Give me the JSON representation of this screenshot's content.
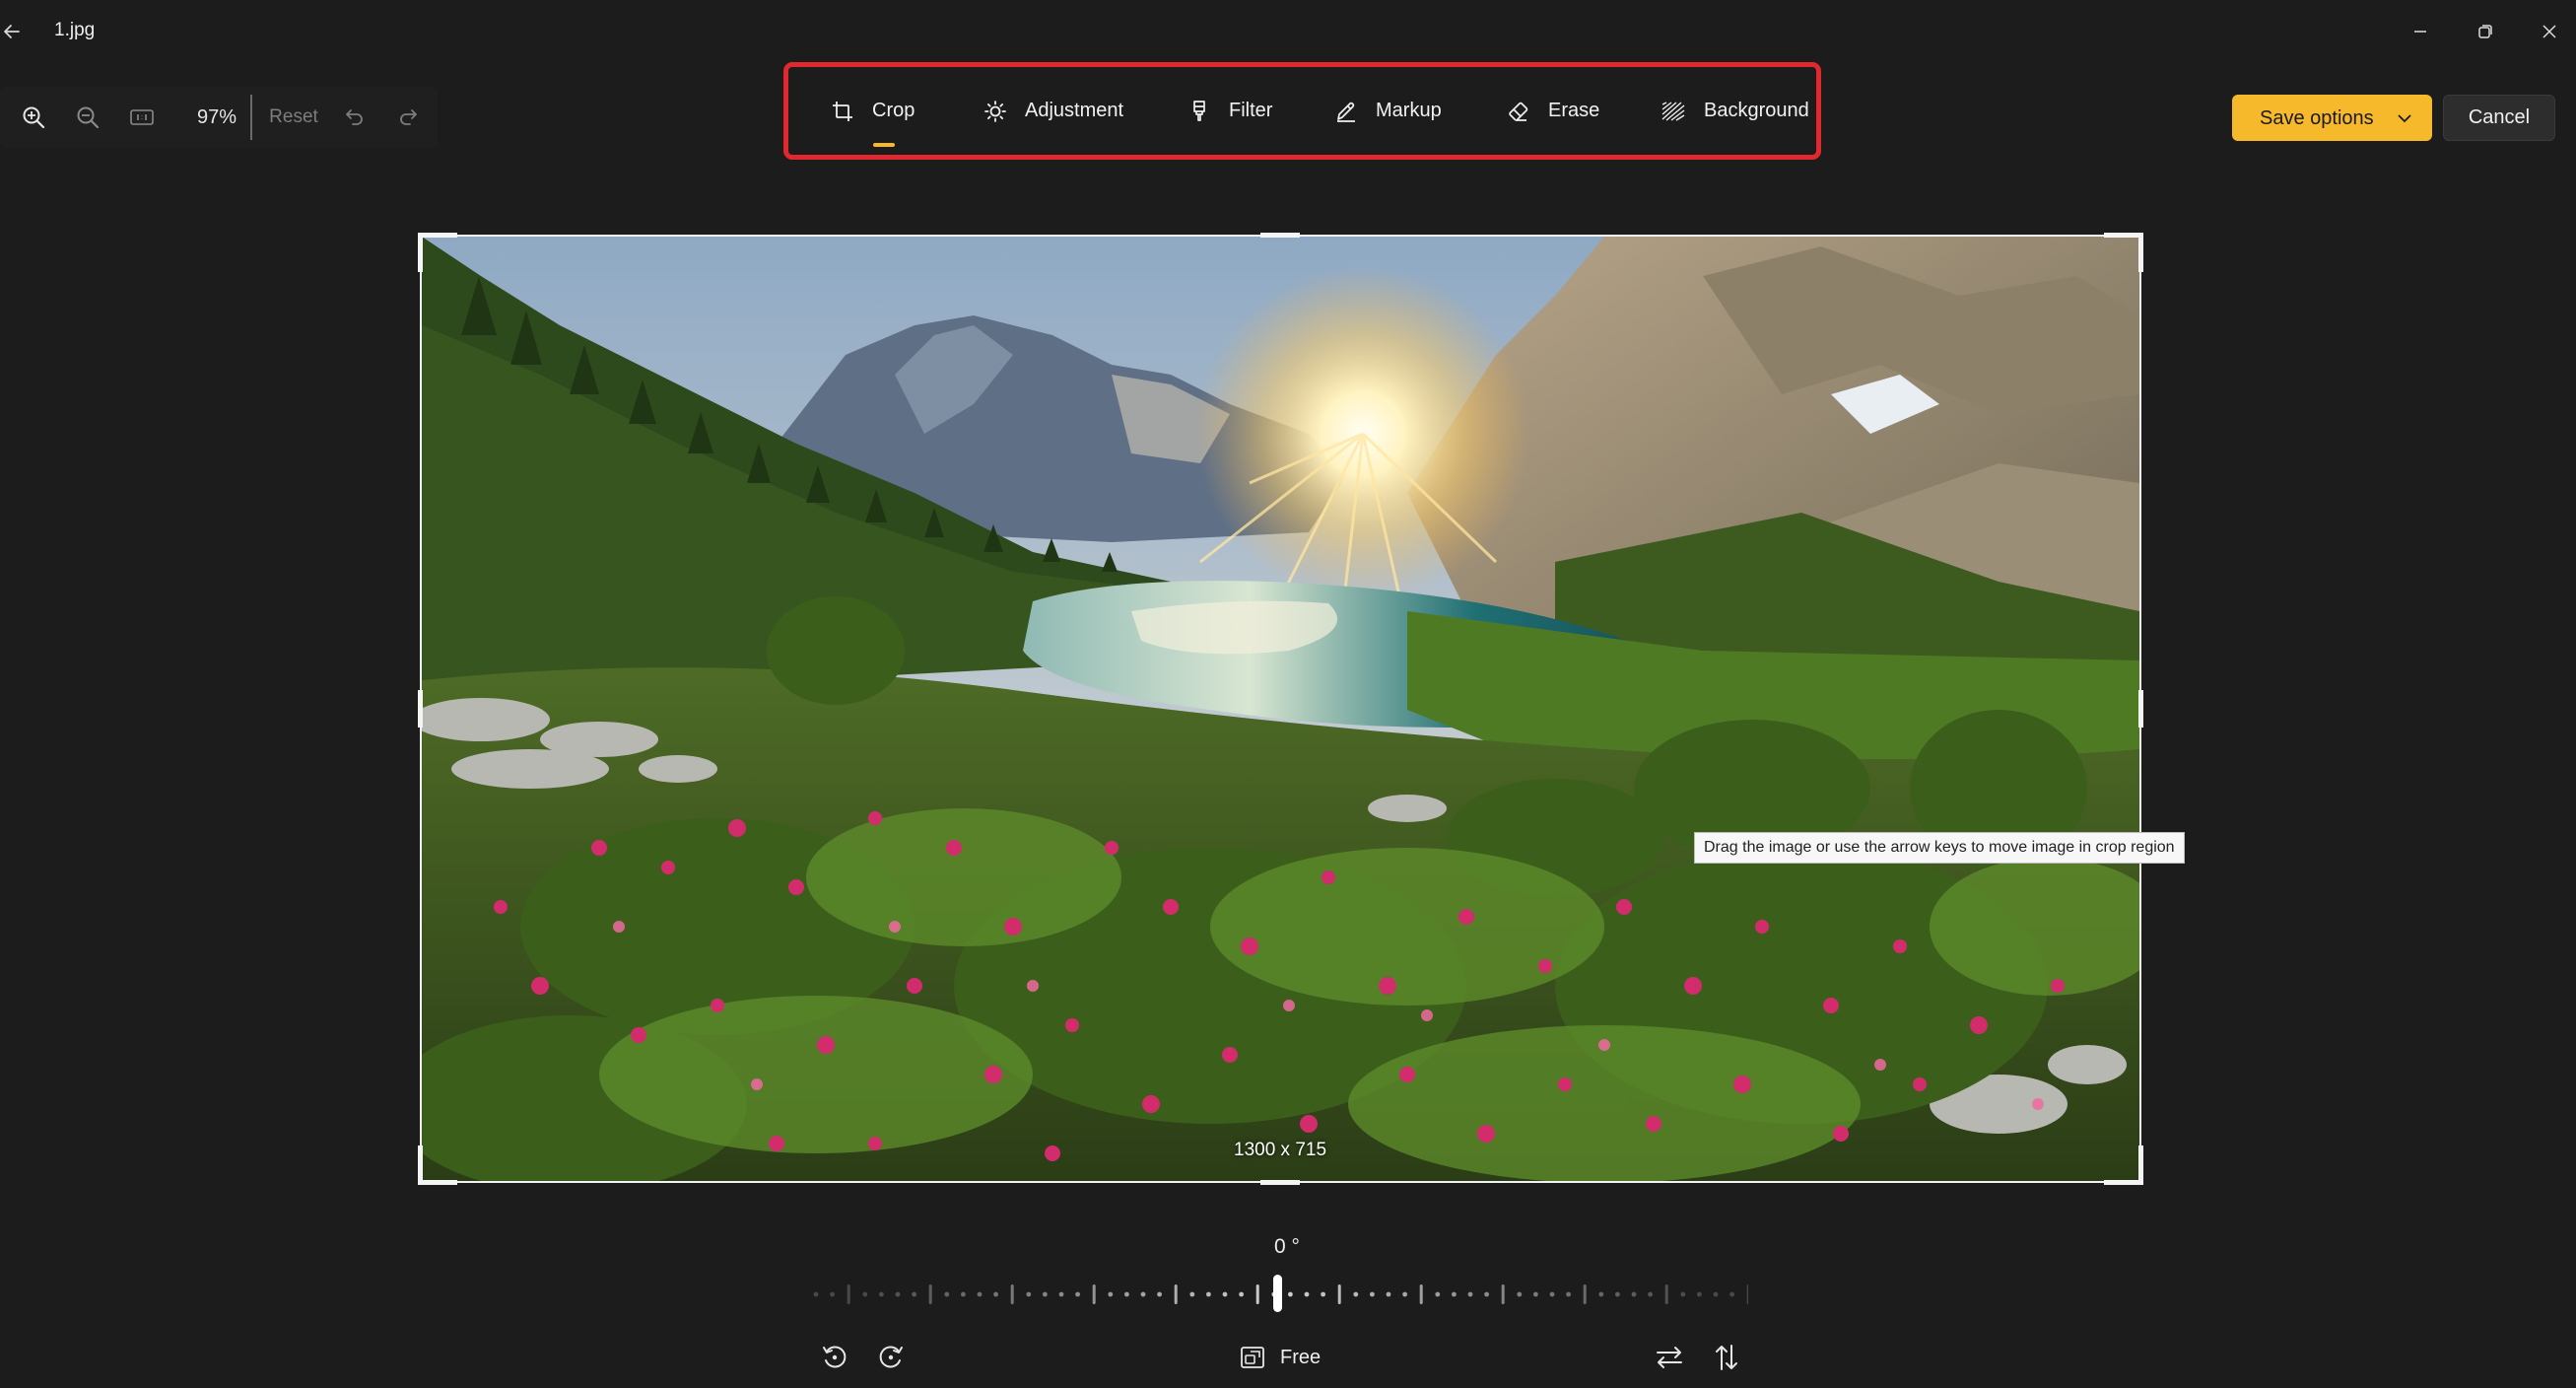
{
  "window": {
    "title": "1.jpg",
    "back_icon": "back-arrow-icon",
    "controls": [
      "minimize-icon",
      "maximize-icon",
      "close-icon"
    ]
  },
  "zoom_toolbar": {
    "zoom_in_icon": "zoom-in-icon",
    "zoom_out_icon": "zoom-out-icon",
    "fit_icon": "actual-size-icon",
    "zoom_percent": "97%",
    "reset_label": "Reset",
    "undo_icon": "undo-icon",
    "redo_icon": "redo-icon"
  },
  "edit_tabs": [
    {
      "label": "Crop",
      "icon": "crop-icon",
      "active": true
    },
    {
      "label": "Adjustment",
      "icon": "brightness-icon",
      "active": false
    },
    {
      "label": "Filter",
      "icon": "filter-icon",
      "active": false
    },
    {
      "label": "Markup",
      "icon": "pen-icon",
      "active": false
    },
    {
      "label": "Erase",
      "icon": "eraser-icon",
      "active": false
    },
    {
      "label": "Background",
      "icon": "background-icon",
      "active": false
    }
  ],
  "actions": {
    "save_label": "Save options",
    "cancel_label": "Cancel"
  },
  "canvas": {
    "dimensions_label": "1300 x 715",
    "tooltip": "Drag the image or use the arrow keys to move image in crop region"
  },
  "straighten": {
    "angle_label": "0 °",
    "angle_value": 0
  },
  "bottom_toolbar": {
    "rotate_left_icon": "rotate-left-icon",
    "rotate_right_icon": "rotate-right-icon",
    "aspect_label": "Free",
    "aspect_icon": "aspect-ratio-icon",
    "flip_horizontal_icon": "flip-horizontal-icon",
    "flip_vertical_icon": "flip-vertical-icon"
  },
  "colors": {
    "background": "#1c1c1c",
    "accent": "#f7b92c",
    "highlight_border": "#e0282e"
  }
}
